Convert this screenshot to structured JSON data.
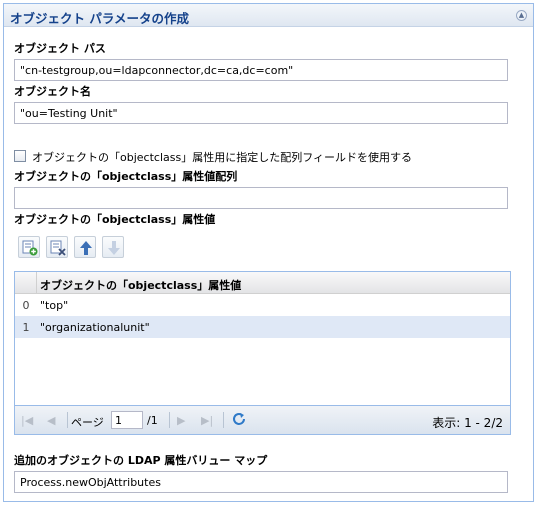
{
  "panel": {
    "title": "オブジェクト パラメータの作成",
    "collapse_icon": "chevron-up-icon"
  },
  "object_path": {
    "label": "オブジェクト パス",
    "value": "\"cn-testgroup,ou=ldapconnector,dc=ca,dc=com\""
  },
  "object_name": {
    "label": "オブジェクト名",
    "value": "\"ou=Testing Unit\""
  },
  "use_array_field": {
    "label": "オブジェクトの「objectclass」属性用に指定した配列フィールドを使用する",
    "checked": false
  },
  "objectclass_array": {
    "label": "オブジェクトの「objectclass」属性値配列",
    "value": ""
  },
  "objectclass_values": {
    "label": "オブジェクトの「objectclass」属性値",
    "toolbar_icons": [
      "add-row-icon",
      "delete-row-icon",
      "move-up-icon",
      "move-down-icon"
    ],
    "grid": {
      "column_header": "オブジェクトの「objectclass」属性値",
      "rows": [
        {
          "index": "0",
          "value": "\"top\"",
          "selected": false
        },
        {
          "index": "1",
          "value": "\"organizationalunit\"",
          "selected": true
        }
      ]
    },
    "pager": {
      "page_label": "ページ",
      "page_value": "1",
      "total_pages": "/1",
      "display": "表示: 1 - 2/2"
    }
  },
  "ldap_attr_map": {
    "label": "追加のオブジェクトの LDAP 属性バリュー マップ",
    "value": "Process.newObjAttributes"
  },
  "colors": {
    "header_title": "#15428b",
    "border": "#99bbe8",
    "selected_row": "#dfe8f6"
  }
}
